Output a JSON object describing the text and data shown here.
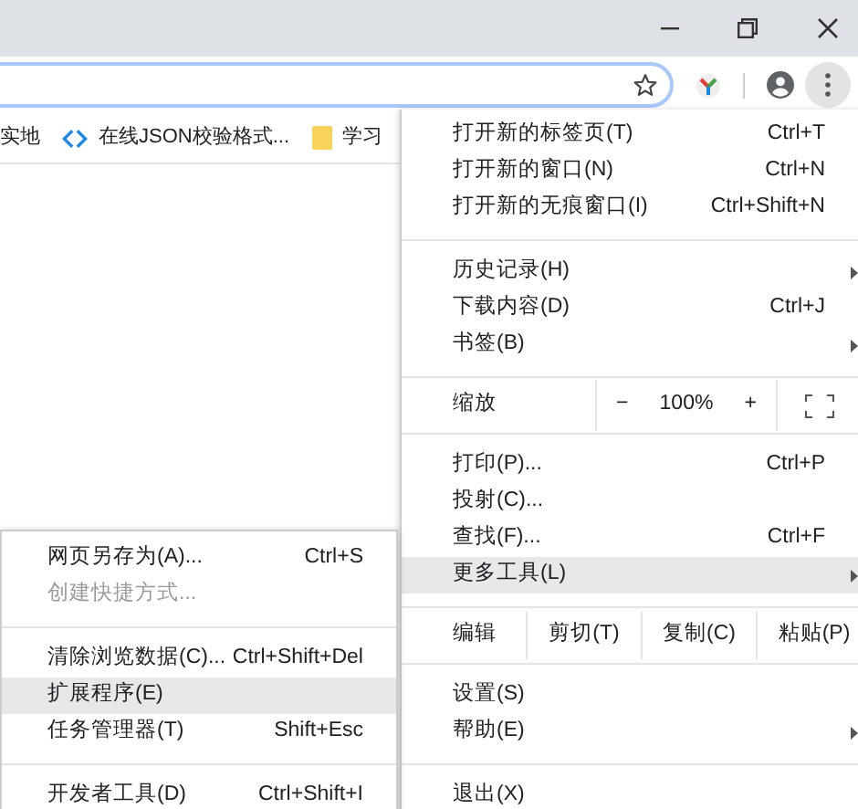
{
  "bookmarks": [
    {
      "label": "实地",
      "kind": "plain"
    },
    {
      "label": "在线JSON校验格式...",
      "kind": "code"
    },
    {
      "label": "学习",
      "kind": "folder"
    }
  ],
  "main_menu": {
    "groups": [
      [
        {
          "label": "打开新的标签页(T)",
          "shortcut": "Ctrl+T"
        },
        {
          "label": "打开新的窗口(N)",
          "shortcut": "Ctrl+N"
        },
        {
          "label": "打开新的无痕窗口(I)",
          "shortcut": "Ctrl+Shift+N"
        }
      ],
      [
        {
          "label": "历史记录(H)",
          "has_submenu": true
        },
        {
          "label": "下载内容(D)",
          "shortcut": "Ctrl+J"
        },
        {
          "label": "书签(B)",
          "has_submenu": true
        }
      ],
      [
        {
          "kind": "zoom",
          "label": "缩放",
          "minus": "−",
          "value": "100%",
          "plus": "+"
        }
      ],
      [
        {
          "label": "打印(P)...",
          "shortcut": "Ctrl+P"
        },
        {
          "label": "投射(C)..."
        },
        {
          "label": "查找(F)...",
          "shortcut": "Ctrl+F"
        },
        {
          "label": "更多工具(L)",
          "has_submenu": true,
          "highlighted": true
        }
      ],
      [
        {
          "kind": "edit",
          "label": "编辑",
          "actions": [
            "剪切(T)",
            "复制(C)",
            "粘贴(P)"
          ]
        }
      ],
      [
        {
          "label": "设置(S)"
        },
        {
          "label": "帮助(E)",
          "has_submenu": true
        }
      ],
      [
        {
          "label": "退出(X)"
        }
      ]
    ]
  },
  "submenu": {
    "groups": [
      [
        {
          "label": "网页另存为(A)...",
          "shortcut": "Ctrl+S",
          "disabled": false
        },
        {
          "label": "创建快捷方式...",
          "disabled": true
        }
      ],
      [
        {
          "label": "清除浏览数据(C)...",
          "shortcut": "Ctrl+Shift+Del"
        },
        {
          "label": "扩展程序(E)",
          "highlighted": true
        },
        {
          "label": "任务管理器(T)",
          "shortcut": "Shift+Esc"
        }
      ],
      [
        {
          "label": "开发者工具(D)",
          "shortcut": "Ctrl+Shift+I"
        }
      ]
    ]
  }
}
